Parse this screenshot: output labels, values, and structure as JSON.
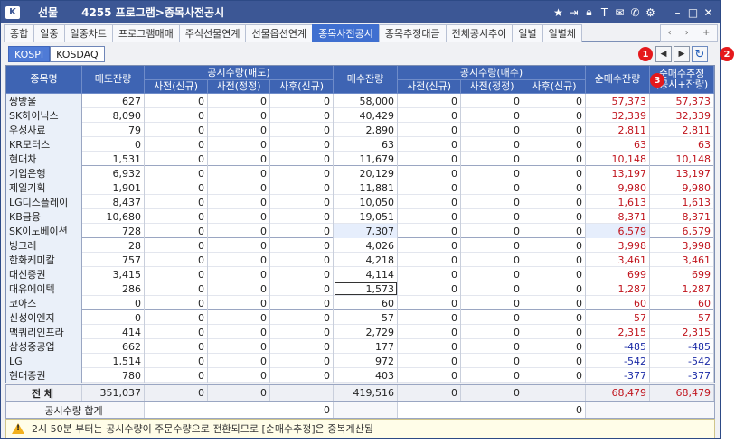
{
  "title_bar": {
    "section": "선물",
    "title": "4255 프로그램>종목사전공시",
    "icons": [
      "star-icon",
      "export-icon",
      "lock-icon",
      "text-icon",
      "chat-icon",
      "phone-icon",
      "settings-icon",
      "minimize-icon",
      "maximize-icon",
      "close-icon"
    ]
  },
  "tabs": [
    "종합",
    "일중",
    "일중차트",
    "프로그램매매",
    "주식선물연계",
    "선물옵션연계",
    "종목사전공시",
    "종목추정대금",
    "전체공시추이",
    "일별",
    "일별체"
  ],
  "tab_nav": [
    "‹",
    "›",
    "+"
  ],
  "market": {
    "kospi": "KOSPI",
    "kosdaq": "KOSDAQ"
  },
  "nav": {
    "prev": "◀",
    "next": "▶",
    "refresh": "↻"
  },
  "badges": [
    "1",
    "2",
    "3"
  ],
  "headers": {
    "name": "종목명",
    "sell_rem": "매도잔량",
    "sell_group": "공시수량(매도)",
    "pre_new": "사전(신규)",
    "pre_fix": "사전(정정)",
    "post_new": "사후(신규)",
    "buy_rem": "매수잔량",
    "buy_group": "공시수량(매수)",
    "net_rem": "순매수잔량",
    "net_est": "순매수추정\n(공시+잔량)"
  },
  "rows": [
    [
      "쌍방울",
      "627",
      "0",
      "0",
      "0",
      "58,000",
      "0",
      "0",
      "0",
      "57,373",
      "57,373"
    ],
    [
      "SK하이닉스",
      "8,090",
      "0",
      "0",
      "0",
      "40,429",
      "0",
      "0",
      "0",
      "32,339",
      "32,339"
    ],
    [
      "우성사료",
      "79",
      "0",
      "0",
      "0",
      "2,890",
      "0",
      "0",
      "0",
      "2,811",
      "2,811"
    ],
    [
      "KR모터스",
      "0",
      "0",
      "0",
      "0",
      "63",
      "0",
      "0",
      "0",
      "63",
      "63"
    ],
    [
      "현대차",
      "1,531",
      "0",
      "0",
      "0",
      "11,679",
      "0",
      "0",
      "0",
      "10,148",
      "10,148"
    ],
    [
      "기업은행",
      "6,932",
      "0",
      "0",
      "0",
      "20,129",
      "0",
      "0",
      "0",
      "13,197",
      "13,197"
    ],
    [
      "제일기획",
      "1,901",
      "0",
      "0",
      "0",
      "11,881",
      "0",
      "0",
      "0",
      "9,980",
      "9,980"
    ],
    [
      "LG디스플레이",
      "8,437",
      "0",
      "0",
      "0",
      "10,050",
      "0",
      "0",
      "0",
      "1,613",
      "1,613"
    ],
    [
      "KB금융",
      "10,680",
      "0",
      "0",
      "0",
      "19,051",
      "0",
      "0",
      "0",
      "8,371",
      "8,371"
    ],
    [
      "SK이노베이션",
      "728",
      "0",
      "0",
      "0",
      "7,307",
      "0",
      "0",
      "0",
      "6,579",
      "6,579"
    ],
    [
      "빙그레",
      "28",
      "0",
      "0",
      "0",
      "4,026",
      "0",
      "0",
      "0",
      "3,998",
      "3,998"
    ],
    [
      "한화케미칼",
      "757",
      "0",
      "0",
      "0",
      "4,218",
      "0",
      "0",
      "0",
      "3,461",
      "3,461"
    ],
    [
      "대신증권",
      "3,415",
      "0",
      "0",
      "0",
      "4,114",
      "0",
      "0",
      "0",
      "699",
      "699"
    ],
    [
      "대유에이텍",
      "286",
      "0",
      "0",
      "0",
      "1,573",
      "0",
      "0",
      "0",
      "1,287",
      "1,287"
    ],
    [
      "코아스",
      "0",
      "0",
      "0",
      "0",
      "60",
      "0",
      "0",
      "0",
      "60",
      "60"
    ],
    [
      "신성이엔지",
      "0",
      "0",
      "0",
      "0",
      "57",
      "0",
      "0",
      "0",
      "57",
      "57"
    ],
    [
      "맥쿼리인프라",
      "414",
      "0",
      "0",
      "0",
      "2,729",
      "0",
      "0",
      "0",
      "2,315",
      "2,315"
    ],
    [
      "삼성중공업",
      "662",
      "0",
      "0",
      "0",
      "177",
      "0",
      "0",
      "0",
      "-485",
      "-485"
    ],
    [
      "LG",
      "1,514",
      "0",
      "0",
      "0",
      "972",
      "0",
      "0",
      "0",
      "-542",
      "-542"
    ],
    [
      "현대증권",
      "780",
      "0",
      "0",
      "0",
      "403",
      "0",
      "0",
      "0",
      "-377",
      "-377"
    ]
  ],
  "total": {
    "label": "전  체",
    "values": [
      "351,037",
      "0",
      "0",
      "",
      "419,516",
      "0",
      "0",
      "",
      "68,479",
      "68,479"
    ]
  },
  "disclosure_sum": {
    "label": "공시수량 합계",
    "sell": "0",
    "buy": "0"
  },
  "note": "2시 50분 부터는 공시수량이 주문수량으로 전환되므로 [순매수추정]은 중복계산됨",
  "colors": {
    "header": "#3e64b3",
    "title": "#3c5795",
    "positive": "#c0141d",
    "negative": "#1a2aa6",
    "active_tab": "#3f6fd0"
  }
}
